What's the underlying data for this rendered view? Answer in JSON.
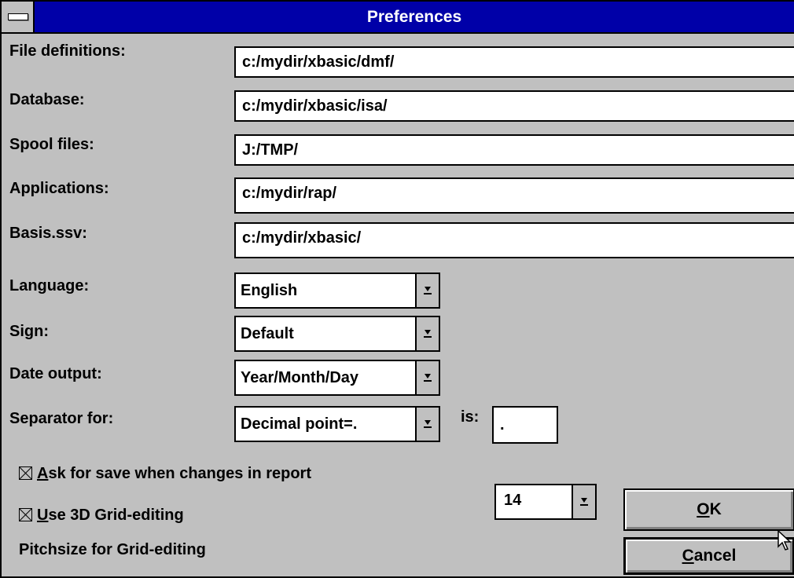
{
  "window": {
    "title": "Preferences"
  },
  "paths": [
    {
      "label": "File definitions:",
      "value": "c:/mydir/xbasic/dmf/"
    },
    {
      "label": "Database:",
      "value": "c:/mydir/xbasic/isa/"
    },
    {
      "label": "Spool files:",
      "value": "J:/TMP/"
    },
    {
      "label": "Applications:",
      "value": "c:/mydir/rap/"
    },
    {
      "label": "Basis.ssv:",
      "value": "c:/mydir/xbasic/"
    }
  ],
  "options": {
    "language": {
      "label": "Language:",
      "value": "English"
    },
    "sign": {
      "label": "Sign:",
      "value": "Default"
    },
    "date_output": {
      "label": "Date output:",
      "value": "Year/Month/Day"
    },
    "separator": {
      "label": "Separator for:",
      "value": "Decimal point=.",
      "is_label": "is:",
      "is_value": "."
    }
  },
  "checkboxes": [
    {
      "mnemonic": "A",
      "rest": "sk for save when changes in report",
      "checked": true
    },
    {
      "mnemonic": "U",
      "rest": "se 3D Grid-editing",
      "checked": true
    }
  ],
  "pitch": {
    "label": "Pitchsize for Grid-editing",
    "value": "14"
  },
  "buttons": {
    "ok_mnemonic": "O",
    "ok_rest": "K",
    "cancel_mnemonic": "C",
    "cancel_rest": "ancel"
  },
  "icons": {
    "system_menu": "system-menu-icon",
    "dropdown": "dropdown-arrow-icon",
    "checkbox": "checkbox-checked-icon",
    "cursor": "mouse-pointer-icon"
  },
  "colors": {
    "titlebar": "#0000a8",
    "face": "#c0c0c0"
  }
}
